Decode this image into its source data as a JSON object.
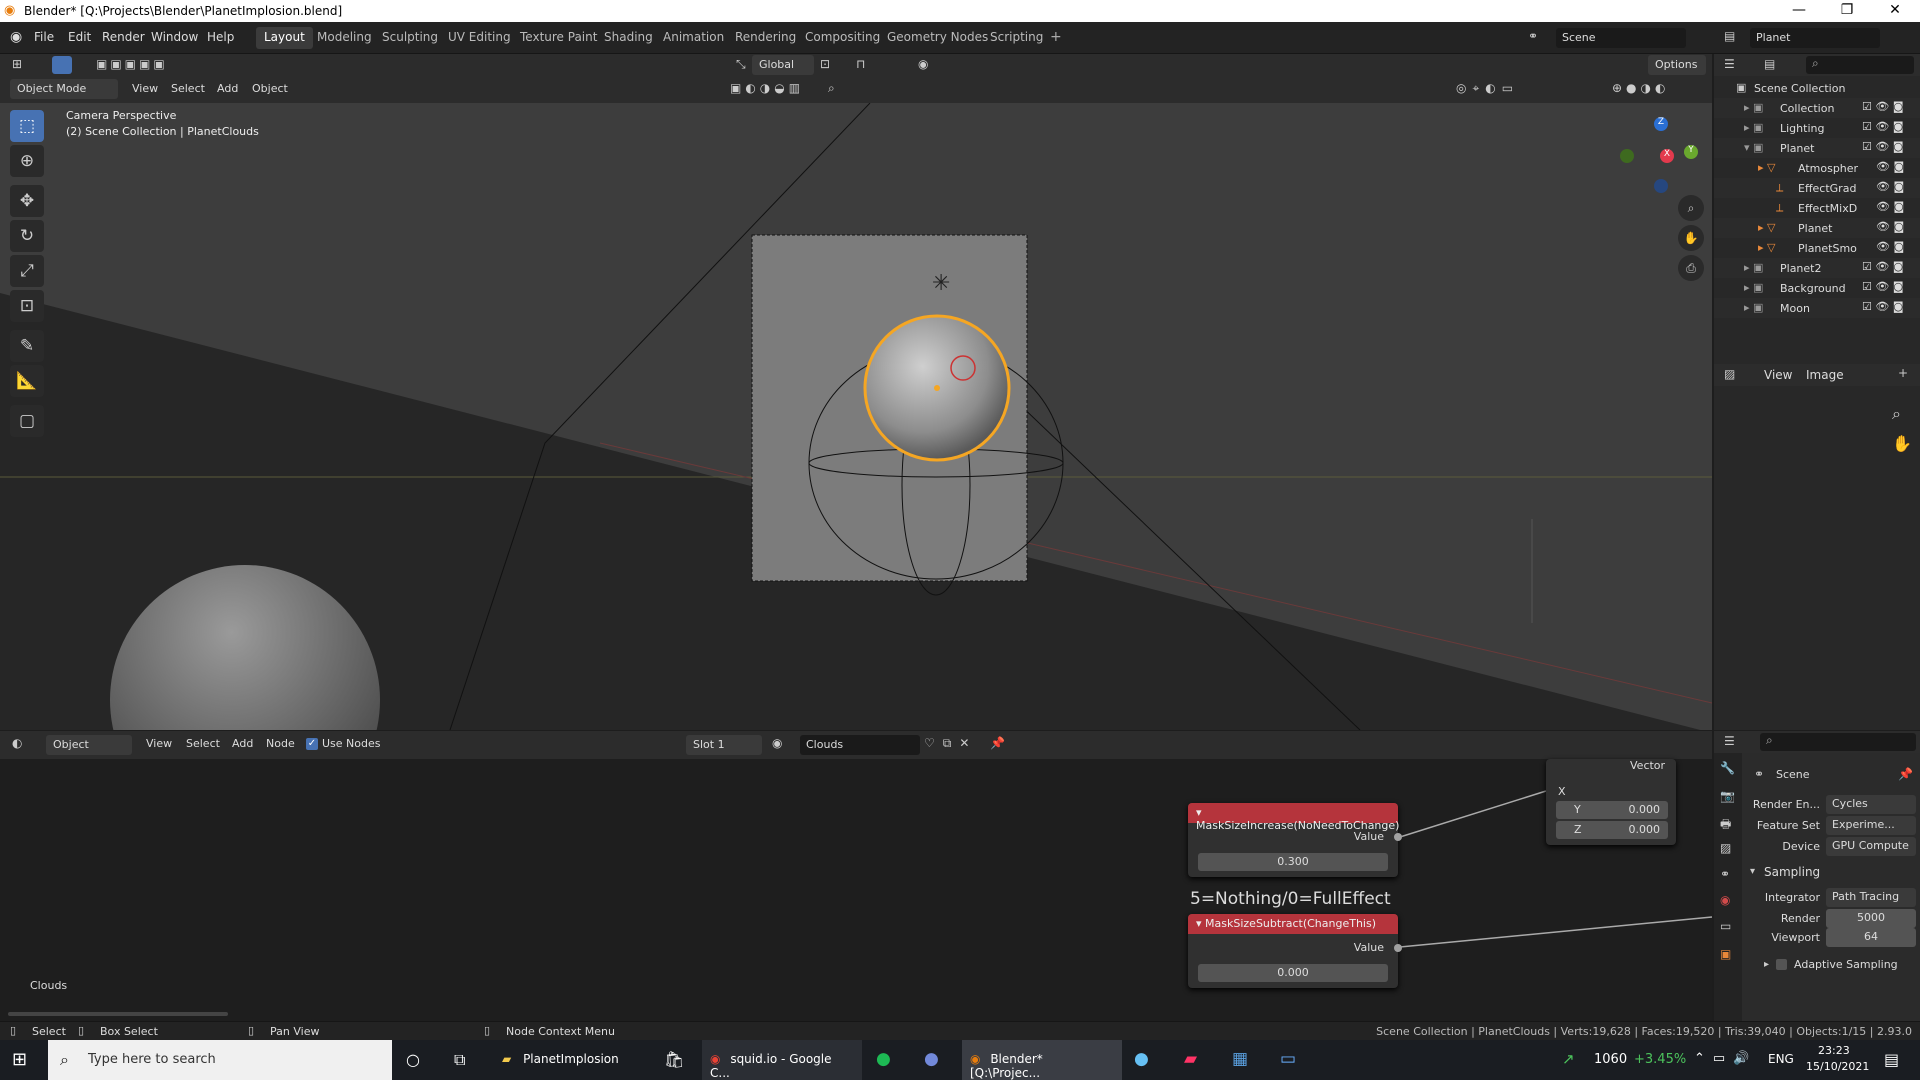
{
  "window": {
    "title": "Blender* [Q:\\Projects\\Blender\\PlanetImplosion.blend]"
  },
  "menu": [
    "File",
    "Edit",
    "Render",
    "Window",
    "Help"
  ],
  "workspaces": [
    "Layout",
    "Modeling",
    "Sculpting",
    "UV Editing",
    "Texture Paint",
    "Shading",
    "Animation",
    "Rendering",
    "Compositing",
    "Geometry Nodes",
    "Scripting"
  ],
  "topbar": {
    "scene": "Scene",
    "view_layer": "Planet",
    "options": "Options"
  },
  "viewport": {
    "mode": "Object Mode",
    "menus": [
      "View",
      "Select",
      "Add",
      "Object"
    ],
    "orientation": "Global",
    "info_line1": "Camera Perspective",
    "info_line2": "(2) Scene Collection | PlanetClouds",
    "gizmo": {
      "z": "Z",
      "x": "X",
      "y": "Y"
    }
  },
  "outliner": {
    "root": "Scene Collection",
    "items": [
      {
        "label": "Collection"
      },
      {
        "label": "Lighting"
      },
      {
        "label": "Planet"
      },
      {
        "label": "Atmospher"
      },
      {
        "label": "EffectGrad"
      },
      {
        "label": "EffectMixD"
      },
      {
        "label": "Planet"
      },
      {
        "label": "PlanetSmo"
      },
      {
        "label": "Planet2"
      },
      {
        "label": "Background"
      },
      {
        "label": "Moon"
      }
    ]
  },
  "image_editor": {
    "view": "View",
    "image": "Image"
  },
  "node_editor": {
    "object": "Object",
    "menus": [
      "View",
      "Select",
      "Add",
      "Node"
    ],
    "use_nodes": "Use Nodes",
    "slot": "Slot 1",
    "material": "Clouds",
    "vector_label": "Vector",
    "x_label": "X",
    "y_label": "Y",
    "y_value": "0.000",
    "z_label": "Z",
    "z_value": "0.000",
    "node1": {
      "title": "MaskSizeIncrease(NoNeedToChange)",
      "output": "Value",
      "value": "0.300"
    },
    "frame_label": "5=Nothing/0=FullEffect",
    "node2": {
      "title": "MaskSizeSubtract(ChangeThis)",
      "output": "Value",
      "value": "0.000"
    },
    "tree_label": "Clouds"
  },
  "properties": {
    "scene": "Scene",
    "render_engine_label": "Render En...",
    "render_engine": "Cycles",
    "feature_set_label": "Feature Set",
    "feature_set": "Experime...",
    "device_label": "Device",
    "device": "GPU Compute",
    "sampling": "Sampling",
    "integrator_label": "Integrator",
    "integrator": "Path Tracing",
    "render_label": "Render",
    "render_samples": "5000",
    "viewport_label": "Viewport",
    "viewport_samples": "64",
    "adaptive": "Adaptive Sampling"
  },
  "statusbar": {
    "select": "Select",
    "box_select": "Box Select",
    "pan": "Pan View",
    "context": "Node Context Menu",
    "stats": "Scene Collection | PlanetClouds | Verts:19,628 | Faces:19,520 | Tris:39,040 | Objects:1/15 | 2.93.0"
  },
  "taskbar": {
    "search": "Type here to search",
    "folder": "PlanetImplosion",
    "chrome": "squid.io - Google C...",
    "blender": "Blender* [Q:\\Projec...",
    "stock": "1060",
    "stock_change": "+3.45%",
    "lang": "ENG",
    "time": "23:23",
    "date": "15/10/2021"
  },
  "colors": {
    "accent": "#4772b3",
    "node_header": "#b5343c",
    "selection": "#f5a623",
    "stock_up": "#4cc35c"
  }
}
